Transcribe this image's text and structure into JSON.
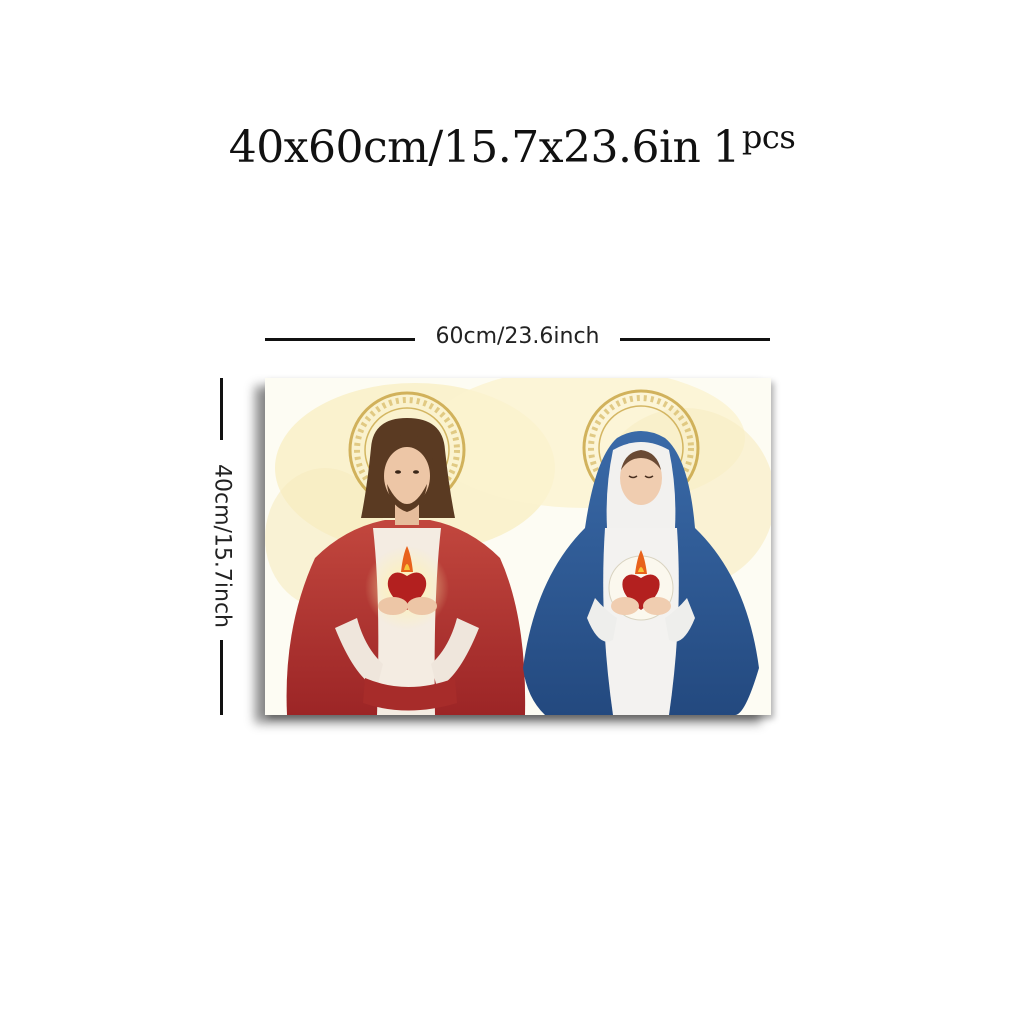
{
  "title": {
    "main": "40x60cm/15.7x23.6in",
    "count": "1",
    "unit": "pcs"
  },
  "dimensions": {
    "width_label": "60cm/23.6inch",
    "height_label": "40cm/15.7inch"
  },
  "artwork": {
    "figures": [
      "jesus-figure",
      "mary-figure"
    ]
  },
  "colors": {
    "text": "#111111",
    "robe_red": "#b8322f",
    "mantle_blue": "#2f5e9c",
    "halo_gold": "#c9a646",
    "background_cream": "#fbf6dc"
  }
}
